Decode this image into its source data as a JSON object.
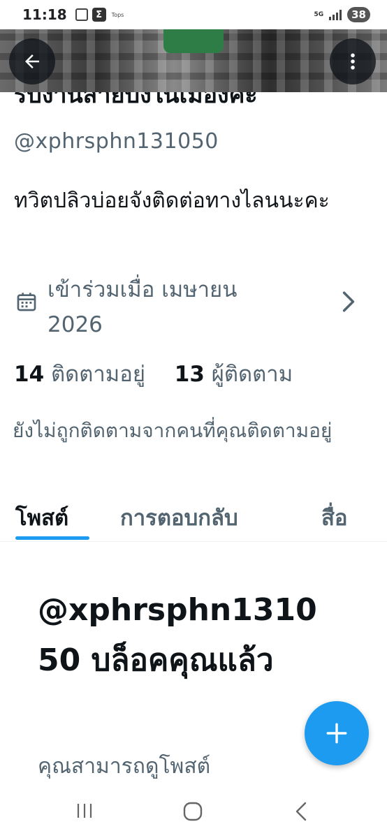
{
  "status_bar": {
    "time": "11:18",
    "app_icon_label": "Σ",
    "app_name": "Tops",
    "network": "5G",
    "battery": "38"
  },
  "profile": {
    "display_name": "รับงานสายบังในเมืองค่ะ",
    "handle": "@xphrsphn131050",
    "bio": "ทวิตปลิวบ่อยจังติดต่อทางไลนนะคะ",
    "joined": "เข้าร่วมเมื่อ เมษายน 2026",
    "following_count": "14",
    "following_label": "ติดตามอยู่",
    "followers_count": "13",
    "followers_label": "ผู้ติดตาม",
    "not_followed_text": "ยังไม่ถูกติดตามจากคนที่คุณติดตามอยู่"
  },
  "tabs": [
    {
      "label": "โพสต์",
      "active": true
    },
    {
      "label": "การตอบกลับ",
      "active": false
    },
    {
      "label": "สื่อ",
      "active": false
    }
  ],
  "blocked": {
    "title": "@xphrsphn131050 บล็อคคุณแล้ว",
    "subtitle": "คุณสามารถดูโพสต์"
  },
  "icons": {
    "back": "arrow-left-icon",
    "more": "more-vertical-icon",
    "calendar": "calendar-icon",
    "chevron": "chevron-right-icon",
    "compose": "plus-icon"
  },
  "colors": {
    "accent": "#1d9bf0",
    "text_primary": "#0f1419",
    "text_secondary": "#536471"
  }
}
